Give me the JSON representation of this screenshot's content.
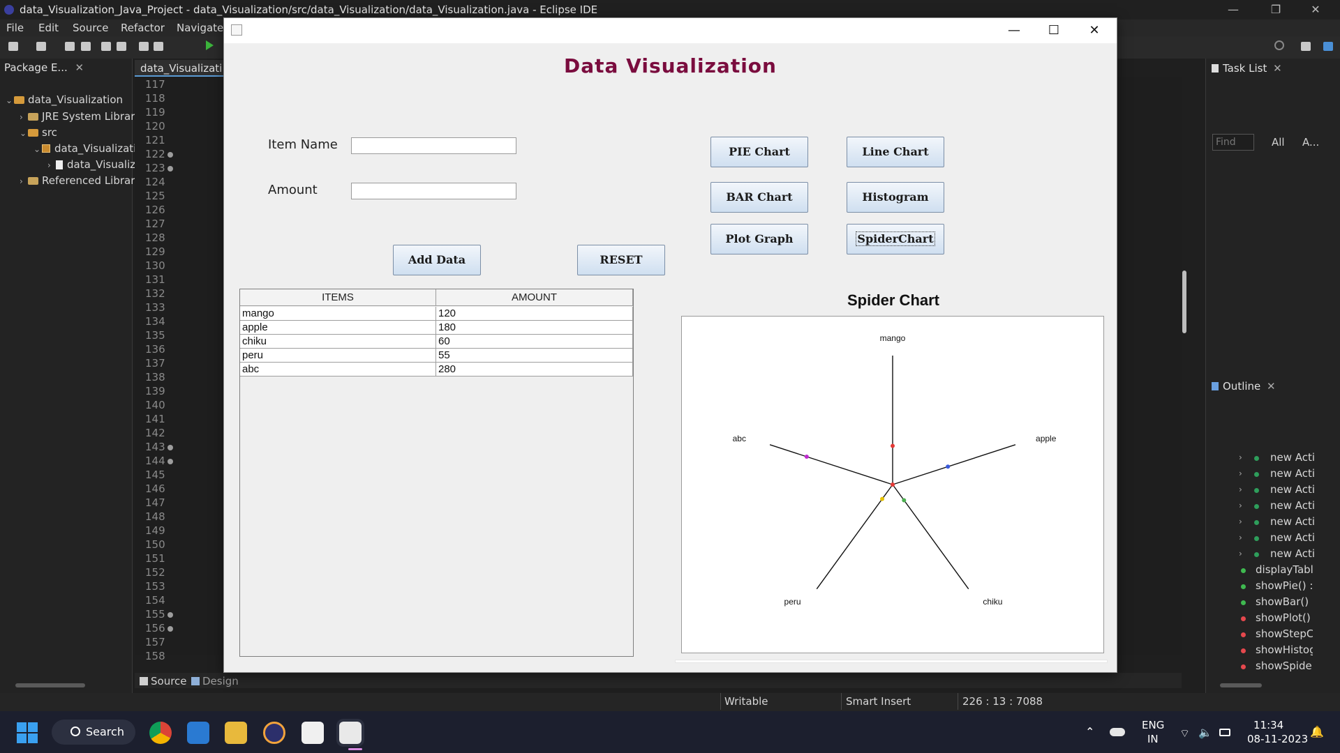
{
  "window": {
    "title": "data_Visualization_Java_Project - data_Visualization/src/data_Visualization/data_Visualization.java - Eclipse IDE",
    "controls": [
      "—",
      "❐",
      "✕"
    ]
  },
  "menu": [
    "File",
    "Edit",
    "Source",
    "Refactor",
    "Navigate"
  ],
  "package_explorer": {
    "tab": "Package E...",
    "items": [
      {
        "label": "data_Visualization"
      },
      {
        "label": "JRE System Library"
      },
      {
        "label": "src"
      },
      {
        "label": "data_Visualizati"
      },
      {
        "label": "data_Visualiz"
      },
      {
        "label": "Referenced Librarie"
      }
    ]
  },
  "editor": {
    "tab": "data_Visualizati",
    "line_numbers": [
      "117",
      "118",
      "119",
      "120",
      "121",
      "122",
      "123",
      "124",
      "125",
      "126",
      "127",
      "128",
      "129",
      "130",
      "131",
      "132",
      "133",
      "134",
      "135",
      "136",
      "137",
      "138",
      "139",
      "140",
      "141",
      "142",
      "143",
      "144",
      "145",
      "146",
      "147",
      "148",
      "149",
      "150",
      "151",
      "152",
      "153",
      "154",
      "155",
      "156",
      "157",
      "158"
    ],
    "bottom_tabs": [
      "Source",
      "Design"
    ]
  },
  "task_list": {
    "tab": "Task List",
    "find_placeholder": "Find",
    "all_label": "All",
    "a_label": "A..."
  },
  "outline": {
    "tab": "Outline",
    "items": [
      {
        "label": "new Acti",
        "kind": "class"
      },
      {
        "label": "new Acti",
        "kind": "class"
      },
      {
        "label": "new Acti",
        "kind": "class"
      },
      {
        "label": "new Acti",
        "kind": "class"
      },
      {
        "label": "new Acti",
        "kind": "class"
      },
      {
        "label": "new Acti",
        "kind": "class"
      },
      {
        "label": "new Acti",
        "kind": "class"
      },
      {
        "label": "displayTabl",
        "kind": "public"
      },
      {
        "label": "showPie() :",
        "kind": "public"
      },
      {
        "label": "showBar() :",
        "kind": "public"
      },
      {
        "label": "showPlot()",
        "kind": "private"
      },
      {
        "label": "showStepCl",
        "kind": "private"
      },
      {
        "label": "showHistog",
        "kind": "private"
      },
      {
        "label": "showSpider",
        "kind": "private"
      }
    ],
    "colors": {
      "public": "#3fb950",
      "private": "#e5484d",
      "class": "#2e9e5b"
    }
  },
  "status": {
    "writable": "Writable",
    "insert_mode": "Smart Insert",
    "position": "226 : 13 : 7088"
  },
  "taskbar": {
    "search": "Search",
    "lang": "ENG",
    "region": "IN",
    "time": "11:34",
    "date": "08-11-2023"
  },
  "app": {
    "title": "Data Visualization",
    "item_name_label": "Item Name",
    "item_name_value": "",
    "amount_label": "Amount",
    "amount_value": "",
    "add_button": "Add Data",
    "reset_button": "RESET",
    "chart_buttons": [
      "PIE Chart",
      "Line Chart",
      "BAR Chart",
      "Histogram",
      "Plot Graph",
      "SpiderChart"
    ],
    "table": {
      "headers": [
        "ITEMS",
        "AMOUNT"
      ],
      "rows": [
        [
          "mango",
          "120"
        ],
        [
          "apple",
          "180"
        ],
        [
          "chiku",
          "60"
        ],
        [
          "peru",
          "55"
        ],
        [
          "abc",
          "280"
        ]
      ]
    }
  },
  "chart_data": {
    "type": "radar",
    "title": "Spider Chart",
    "categories": [
      "mango",
      "apple",
      "chiku",
      "peru",
      "abc"
    ],
    "values": [
      120,
      180,
      60,
      55,
      280
    ],
    "point_colors": [
      "#e53935",
      "#3b5bdb",
      "#4caf50",
      "#e6c200",
      "#c02ad0"
    ],
    "max": 400
  }
}
